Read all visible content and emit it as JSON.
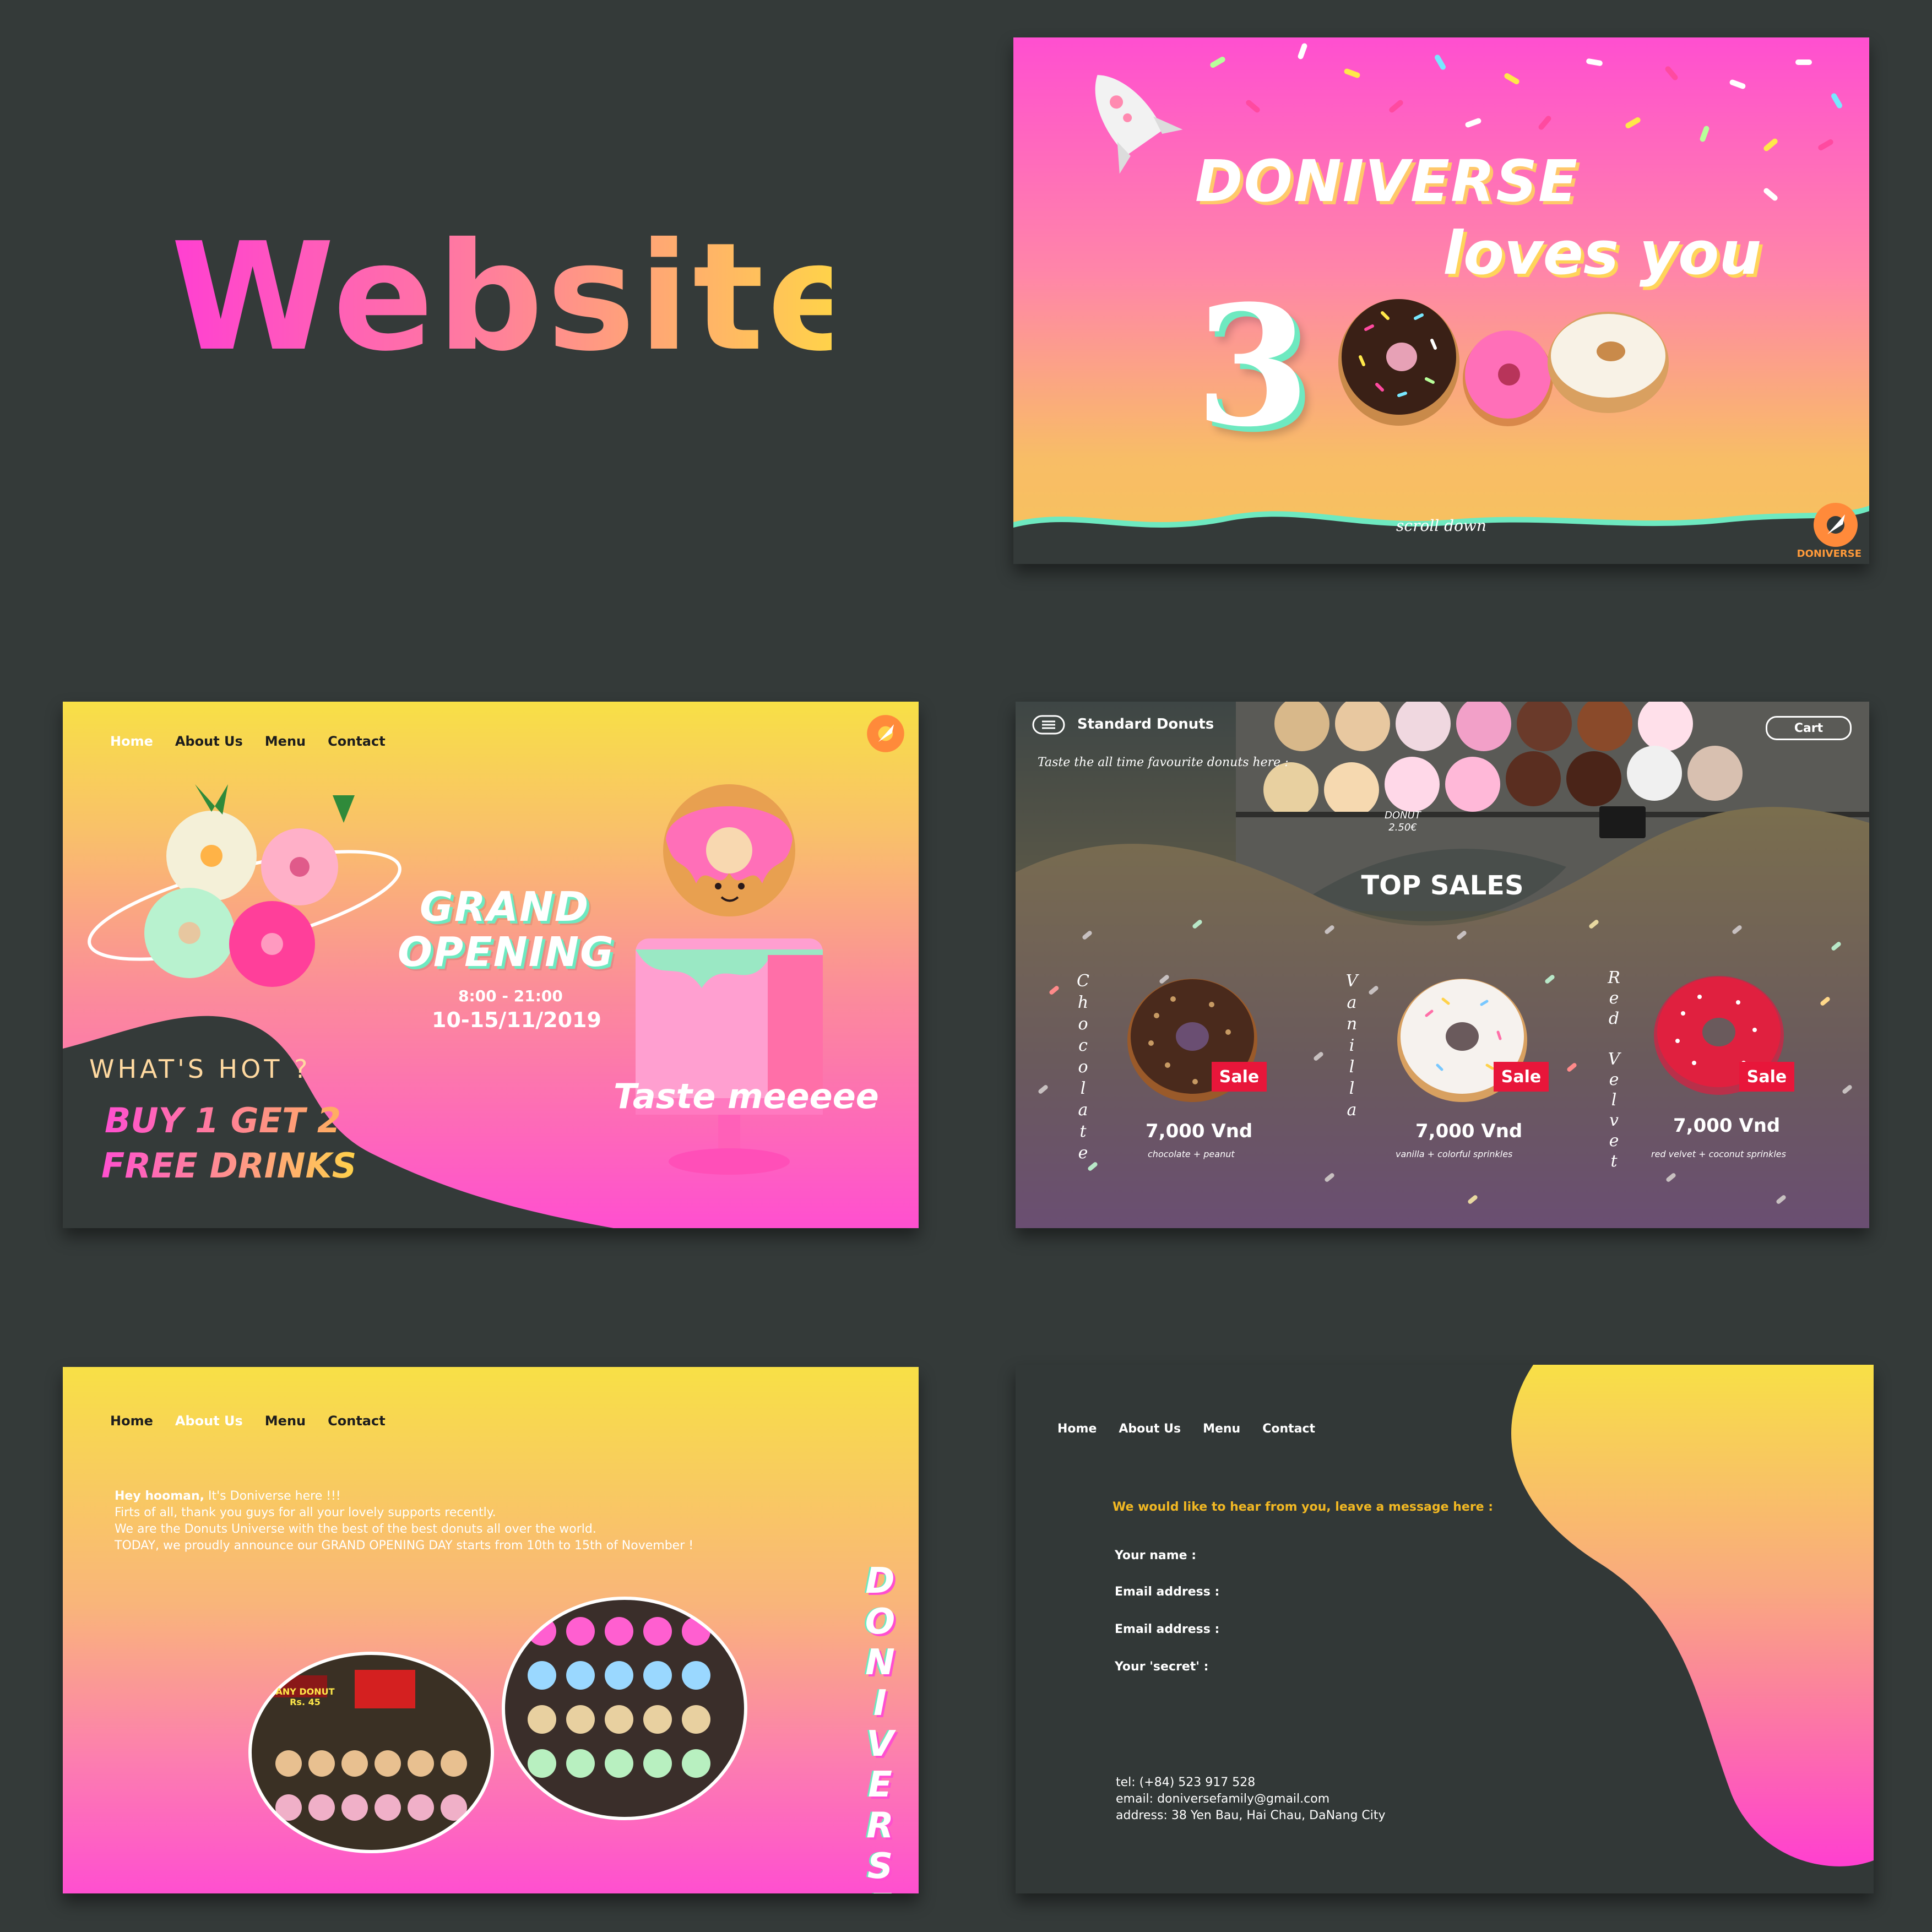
{
  "showcase": {
    "title": "Website"
  },
  "hero": {
    "brand": "DONIVERSE",
    "tagline": "loves you",
    "big_number": "3",
    "scroll_hint": "scroll down",
    "logo_text": "DONIVERSE",
    "colors": {
      "pink": "#ff4fd0",
      "peach": "#f8bd66",
      "mint": "#6ee9c0",
      "dark": "#343a39"
    }
  },
  "opening": {
    "nav": [
      "Home",
      "About Us",
      "Menu",
      "Contact"
    ],
    "active_nav": "Home",
    "logo_text": "DONIVERSE",
    "headline_1": "GRAND",
    "headline_2": "OPENING",
    "hours": "8:00 - 21:00",
    "dates": "10-15/11/2019",
    "hot_label": "WHAT'S HOT ?",
    "promo_1": "BUY 1 GET 2",
    "promo_2": "FREE DRINKS",
    "cake_caption": "Taste meeeee"
  },
  "standard": {
    "title": "Standard Donuts",
    "subtitle": "Taste the all time favourite donuts here :",
    "cart_label": "Cart",
    "section_title": "TOP SALES",
    "price_tag": "DONUT 2.50€",
    "products": [
      {
        "name": "Chocolate",
        "price": "7,000 Vnd",
        "desc": "chocolate + peanut",
        "badge": "Sale",
        "icing": "#4a2a1c",
        "sprinkle": "#c79a63"
      },
      {
        "name": "Vanilla",
        "price": "7,000 Vnd",
        "desc": "vanilla + colorful sprinkles",
        "badge": "Sale",
        "icing": "#f6f2ee",
        "sprinkle": "#ff6fa8"
      },
      {
        "name": "Red Velvet",
        "price": "7,000 Vnd",
        "desc": "red velvet + coconut sprinkles",
        "badge": "Sale",
        "icing": "#e0203f",
        "sprinkle": "#ffffff"
      }
    ]
  },
  "about": {
    "nav": [
      "Home",
      "About Us",
      "Menu",
      "Contact"
    ],
    "active_nav": "About Us",
    "greeting_bold": "Hey hooman,",
    "greeting_rest": " It's Doniverse here !!!",
    "lines": [
      "Firts of all, thank you guys for all your lovely supports recently.",
      "We are the Donuts Universe with the best of the best donuts all over the world.",
      "TODAY, we proudly announce our GRAND OPENING DAY starts from 10th to 15th of November !"
    ],
    "vertical_word": "DONIVERSE",
    "shop_sign": "ANY DONUT Rs. 45"
  },
  "contact": {
    "nav": [
      "Home",
      "About Us",
      "Menu",
      "Contact"
    ],
    "active_nav": "Contact",
    "lead": "We would like to hear from you, leave a message here :",
    "fields": [
      "Your name :",
      "Email address :",
      "Email address :",
      "Your 'secret' :"
    ],
    "tel": "tel: (+84) 523 917 528",
    "email": "email: doniversefamily@gmail.com",
    "address": "address: 38 Yen Bau, Hai Chau, DaNang City"
  }
}
